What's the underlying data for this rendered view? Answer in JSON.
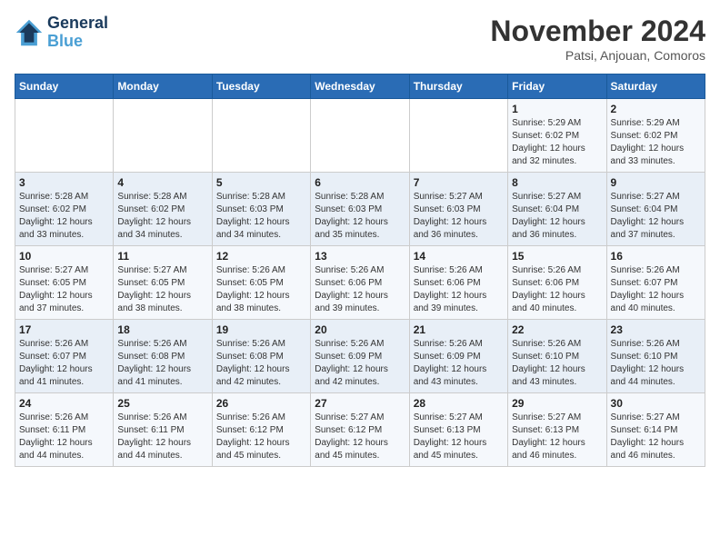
{
  "logo": {
    "line1": "General",
    "line2": "Blue"
  },
  "title": "November 2024",
  "location": "Patsi, Anjouan, Comoros",
  "weekdays": [
    "Sunday",
    "Monday",
    "Tuesday",
    "Wednesday",
    "Thursday",
    "Friday",
    "Saturday"
  ],
  "weeks": [
    [
      {
        "day": "",
        "info": ""
      },
      {
        "day": "",
        "info": ""
      },
      {
        "day": "",
        "info": ""
      },
      {
        "day": "",
        "info": ""
      },
      {
        "day": "",
        "info": ""
      },
      {
        "day": "1",
        "info": "Sunrise: 5:29 AM\nSunset: 6:02 PM\nDaylight: 12 hours\nand 32 minutes."
      },
      {
        "day": "2",
        "info": "Sunrise: 5:29 AM\nSunset: 6:02 PM\nDaylight: 12 hours\nand 33 minutes."
      }
    ],
    [
      {
        "day": "3",
        "info": "Sunrise: 5:28 AM\nSunset: 6:02 PM\nDaylight: 12 hours\nand 33 minutes."
      },
      {
        "day": "4",
        "info": "Sunrise: 5:28 AM\nSunset: 6:02 PM\nDaylight: 12 hours\nand 34 minutes."
      },
      {
        "day": "5",
        "info": "Sunrise: 5:28 AM\nSunset: 6:03 PM\nDaylight: 12 hours\nand 34 minutes."
      },
      {
        "day": "6",
        "info": "Sunrise: 5:28 AM\nSunset: 6:03 PM\nDaylight: 12 hours\nand 35 minutes."
      },
      {
        "day": "7",
        "info": "Sunrise: 5:27 AM\nSunset: 6:03 PM\nDaylight: 12 hours\nand 36 minutes."
      },
      {
        "day": "8",
        "info": "Sunrise: 5:27 AM\nSunset: 6:04 PM\nDaylight: 12 hours\nand 36 minutes."
      },
      {
        "day": "9",
        "info": "Sunrise: 5:27 AM\nSunset: 6:04 PM\nDaylight: 12 hours\nand 37 minutes."
      }
    ],
    [
      {
        "day": "10",
        "info": "Sunrise: 5:27 AM\nSunset: 6:05 PM\nDaylight: 12 hours\nand 37 minutes."
      },
      {
        "day": "11",
        "info": "Sunrise: 5:27 AM\nSunset: 6:05 PM\nDaylight: 12 hours\nand 38 minutes."
      },
      {
        "day": "12",
        "info": "Sunrise: 5:26 AM\nSunset: 6:05 PM\nDaylight: 12 hours\nand 38 minutes."
      },
      {
        "day": "13",
        "info": "Sunrise: 5:26 AM\nSunset: 6:06 PM\nDaylight: 12 hours\nand 39 minutes."
      },
      {
        "day": "14",
        "info": "Sunrise: 5:26 AM\nSunset: 6:06 PM\nDaylight: 12 hours\nand 39 minutes."
      },
      {
        "day": "15",
        "info": "Sunrise: 5:26 AM\nSunset: 6:06 PM\nDaylight: 12 hours\nand 40 minutes."
      },
      {
        "day": "16",
        "info": "Sunrise: 5:26 AM\nSunset: 6:07 PM\nDaylight: 12 hours\nand 40 minutes."
      }
    ],
    [
      {
        "day": "17",
        "info": "Sunrise: 5:26 AM\nSunset: 6:07 PM\nDaylight: 12 hours\nand 41 minutes."
      },
      {
        "day": "18",
        "info": "Sunrise: 5:26 AM\nSunset: 6:08 PM\nDaylight: 12 hours\nand 41 minutes."
      },
      {
        "day": "19",
        "info": "Sunrise: 5:26 AM\nSunset: 6:08 PM\nDaylight: 12 hours\nand 42 minutes."
      },
      {
        "day": "20",
        "info": "Sunrise: 5:26 AM\nSunset: 6:09 PM\nDaylight: 12 hours\nand 42 minutes."
      },
      {
        "day": "21",
        "info": "Sunrise: 5:26 AM\nSunset: 6:09 PM\nDaylight: 12 hours\nand 43 minutes."
      },
      {
        "day": "22",
        "info": "Sunrise: 5:26 AM\nSunset: 6:10 PM\nDaylight: 12 hours\nand 43 minutes."
      },
      {
        "day": "23",
        "info": "Sunrise: 5:26 AM\nSunset: 6:10 PM\nDaylight: 12 hours\nand 44 minutes."
      }
    ],
    [
      {
        "day": "24",
        "info": "Sunrise: 5:26 AM\nSunset: 6:11 PM\nDaylight: 12 hours\nand 44 minutes."
      },
      {
        "day": "25",
        "info": "Sunrise: 5:26 AM\nSunset: 6:11 PM\nDaylight: 12 hours\nand 44 minutes."
      },
      {
        "day": "26",
        "info": "Sunrise: 5:26 AM\nSunset: 6:12 PM\nDaylight: 12 hours\nand 45 minutes."
      },
      {
        "day": "27",
        "info": "Sunrise: 5:27 AM\nSunset: 6:12 PM\nDaylight: 12 hours\nand 45 minutes."
      },
      {
        "day": "28",
        "info": "Sunrise: 5:27 AM\nSunset: 6:13 PM\nDaylight: 12 hours\nand 45 minutes."
      },
      {
        "day": "29",
        "info": "Sunrise: 5:27 AM\nSunset: 6:13 PM\nDaylight: 12 hours\nand 46 minutes."
      },
      {
        "day": "30",
        "info": "Sunrise: 5:27 AM\nSunset: 6:14 PM\nDaylight: 12 hours\nand 46 minutes."
      }
    ]
  ]
}
